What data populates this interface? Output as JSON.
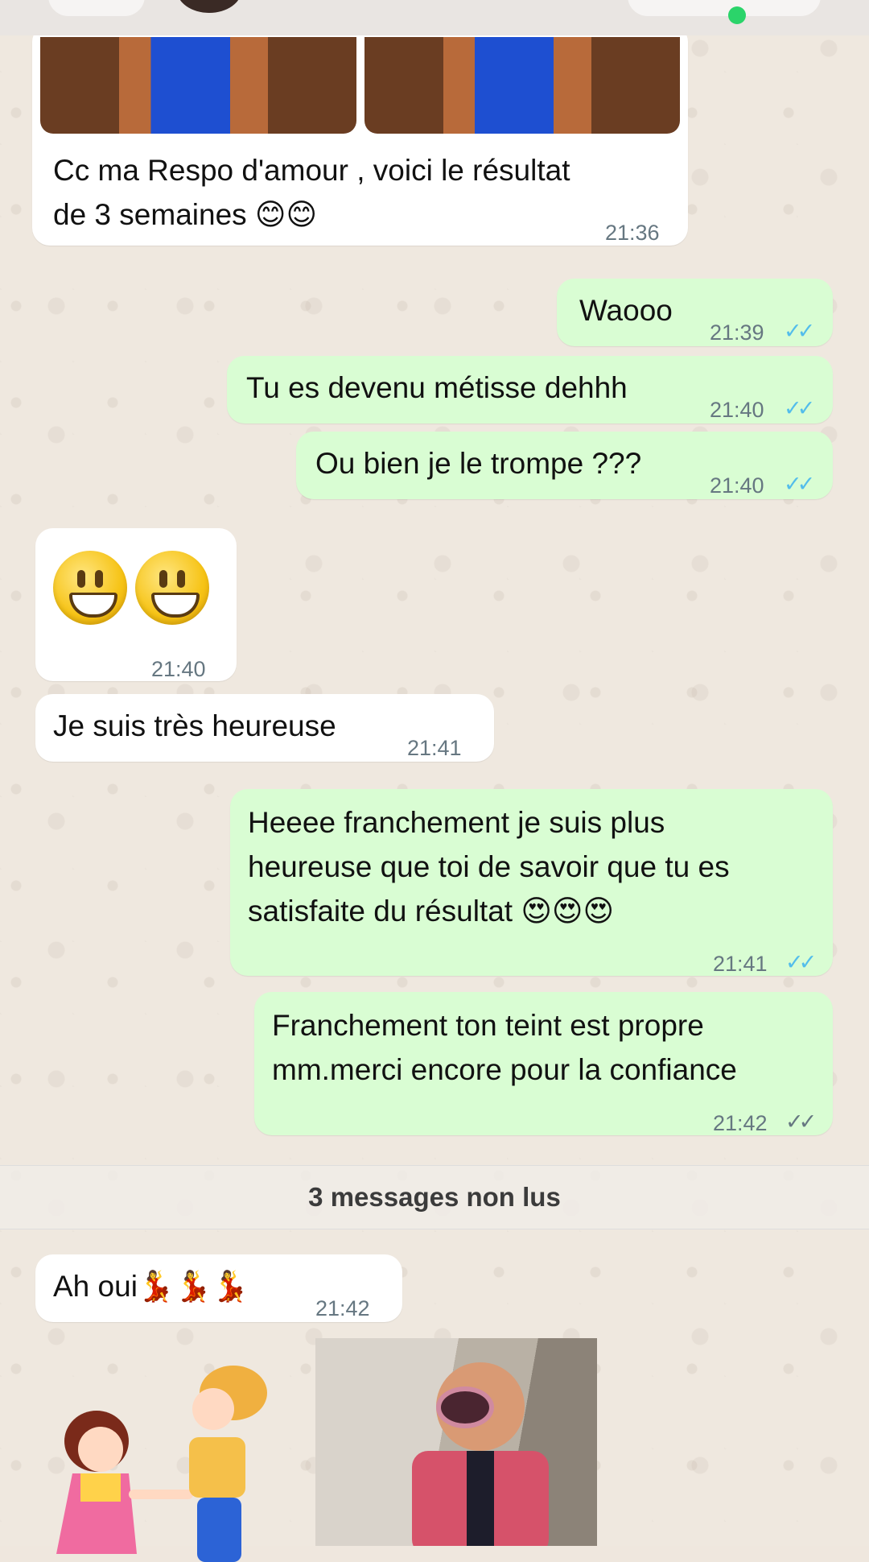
{
  "chat": {
    "unread_divider": "3 messages non lus",
    "messages": [
      {
        "id": "m1",
        "direction": "in",
        "text": "Cc ma Respo d'amour , voici le résultat\nde 3 semaines 😊😊",
        "time": "21:36"
      },
      {
        "id": "m2",
        "direction": "out",
        "text": "Waooo",
        "time": "21:39",
        "status": "read"
      },
      {
        "id": "m3",
        "direction": "out",
        "text": "Tu es devenu métisse dehhh",
        "time": "21:40",
        "status": "read"
      },
      {
        "id": "m4",
        "direction": "out",
        "text": "Ou bien je le trompe ???",
        "time": "21:40",
        "status": "read"
      },
      {
        "id": "m5",
        "direction": "in",
        "emoji": [
          "smiley-icon",
          "smiley-icon"
        ],
        "time": "21:40"
      },
      {
        "id": "m6",
        "direction": "in",
        "text": "Je suis très heureuse",
        "time": "21:41"
      },
      {
        "id": "m7",
        "direction": "out",
        "text": "Heeee franchement je suis plus\nheureuse que toi de savoir que tu es\nsatisfaite du résultat 😍😍😍",
        "time": "21:41",
        "status": "read"
      },
      {
        "id": "m8",
        "direction": "out",
        "text": "Franchement ton teint est propre\nmm.merci encore pour la confiance",
        "time": "21:42",
        "status": "delivered"
      },
      {
        "id": "m9",
        "direction": "in",
        "text": "Ah oui💃💃💃",
        "time": "21:42"
      }
    ]
  },
  "colors": {
    "incoming": "#ffffff",
    "outgoing": "#d9fdd3",
    "read_ticks": "#53bdeb",
    "delivered_ticks": "#667781",
    "online": "#2bd46a"
  }
}
